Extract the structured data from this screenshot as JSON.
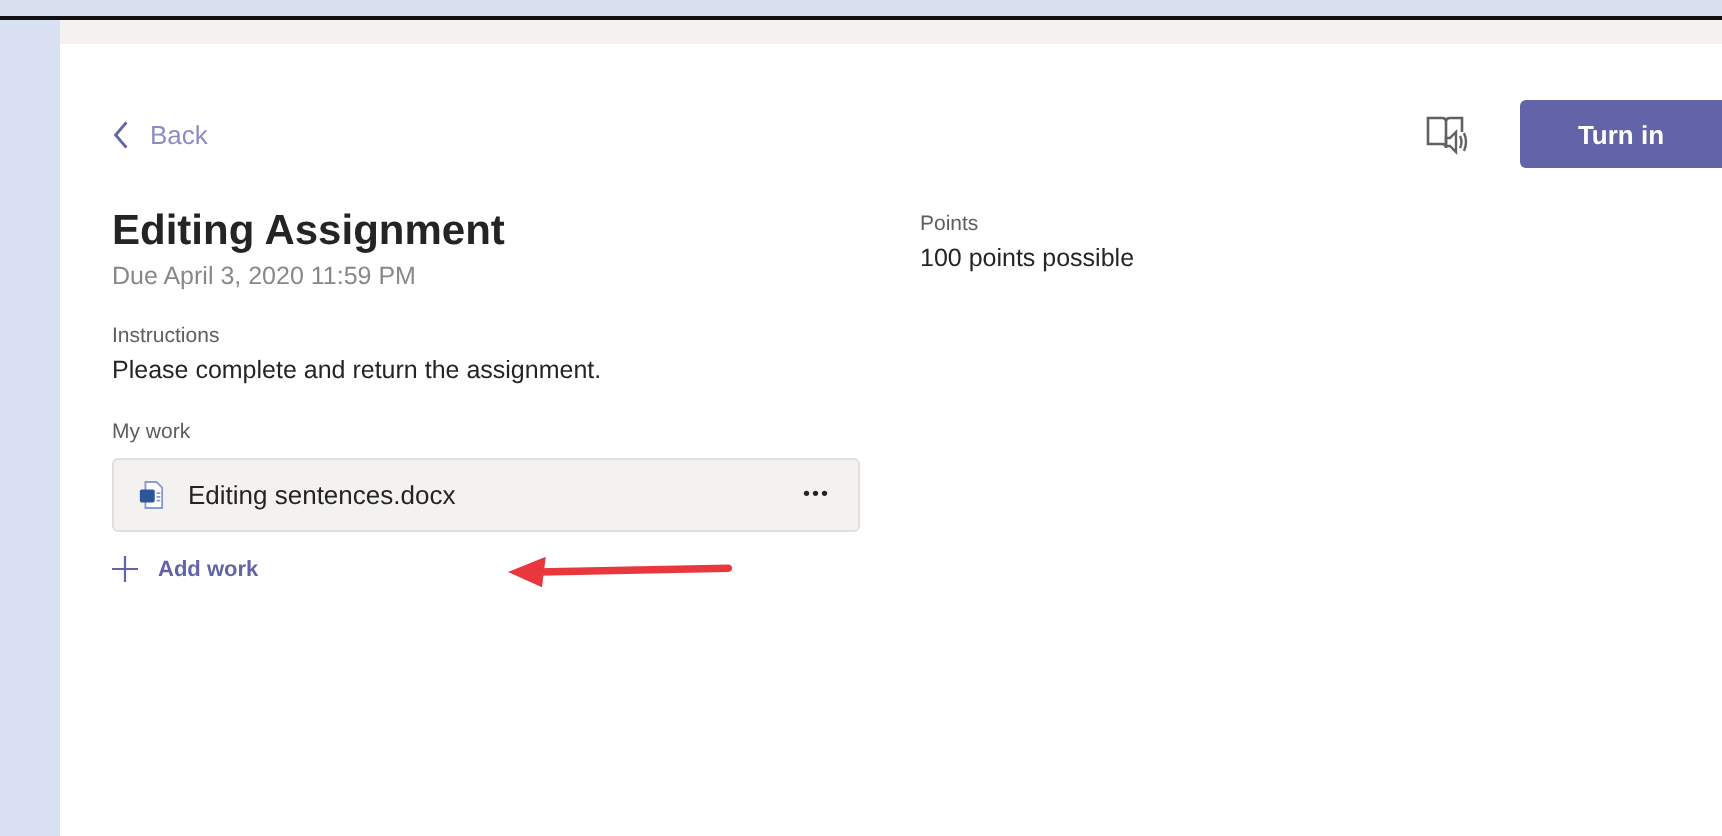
{
  "back": {
    "label": "Back"
  },
  "turn_in_button": {
    "label": "Turn in"
  },
  "assignment": {
    "title": "Editing Assignment",
    "due": "Due April 3, 2020 11:59 PM"
  },
  "instructions": {
    "heading": "Instructions",
    "text": "Please complete and return the assignment."
  },
  "my_work": {
    "heading": "My work",
    "files": [
      {
        "name": "Editing sentences.docx",
        "menu": "•••"
      }
    ],
    "add_label": "Add work"
  },
  "points": {
    "heading": "Points",
    "text": "100 points possible"
  }
}
